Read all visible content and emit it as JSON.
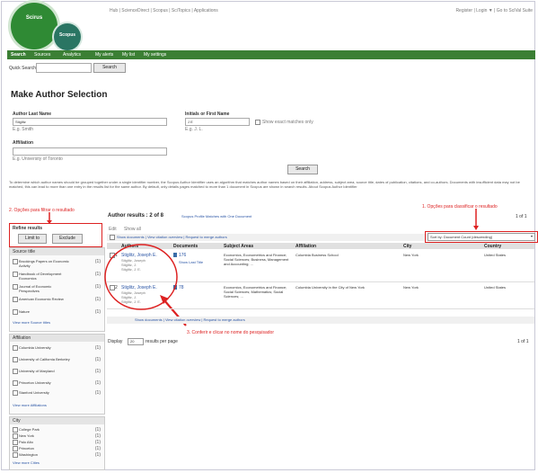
{
  "header": {
    "logo_main": "Scirus",
    "logo_sub": "Scopus",
    "top_links": "Hub | ScienceDirect | Scopus | SciTopics | Applications",
    "user_links": "Register | Login ▼ | Go to SciVal Suite"
  },
  "nav": {
    "items": [
      "Search",
      "Sources",
      "Analytics",
      "My alerts",
      "My list",
      "My settings"
    ]
  },
  "quick_search": {
    "label": "Quick Search",
    "button": "Search"
  },
  "page_title": "Make Author Selection",
  "form": {
    "last_name_label": "Author Last Name",
    "last_name_value": "Stiglitz",
    "last_name_hint": "E.g. Smith",
    "first_name_label": "Initials or First Name",
    "first_name_value": "J E",
    "first_name_hint": "E.g. J. L.",
    "exact_label": "Show exact matches only",
    "affiliation_label": "Affiliation",
    "affiliation_hint": "E.g. University of Toronto",
    "search_button": "Search"
  },
  "info_text": "To determine which author names should be grouped together under a single identifier number, the Scopus Author Identifier uses an algorithm that matches author names based on their affiliation, address, subject area, source title, dates of publication, citations, and co-authors. Documents with insufficient data may not be matched, this can lead to more than one entry in the results list for the same author. By default, only details pages matched to more than 1 document in Scopus are shown in search results. About Scopus Author Identifier",
  "annotations": {
    "refine": "2. Opções para filtrar o resultado",
    "sort": "1. Opções para classificar o resultado",
    "click_name": "3. Conferir e clicar no nome do pesquisador"
  },
  "refine": {
    "title": "Refine results",
    "limit_button": "Limit to",
    "exclude_button": "Exclude"
  },
  "facets": [
    {
      "title": "Source title",
      "items": [
        {
          "label": "Brookings Papers on Economic Activity",
          "count": "(1)"
        },
        {
          "label": "Handbook of Development Economics",
          "count": "(1)"
        },
        {
          "label": "Journal of Economic Perspectives",
          "count": "(1)"
        },
        {
          "label": "American Economic Review",
          "count": "(1)"
        },
        {
          "label": "Nature",
          "count": "(1)"
        }
      ],
      "more": "View more Source titles"
    },
    {
      "title": "Affiliation",
      "items": [
        {
          "label": "Columbia University",
          "count": "(1)"
        },
        {
          "label": "University of California Berkeley",
          "count": "(1)"
        },
        {
          "label": "University of Maryland",
          "count": "(1)"
        },
        {
          "label": "Princeton University",
          "count": "(1)"
        },
        {
          "label": "Stanford University",
          "count": "(1)"
        }
      ],
      "more": "View more Affiliations"
    },
    {
      "title": "City",
      "items": [
        {
          "label": "College Park",
          "count": "(1)"
        },
        {
          "label": "New York",
          "count": "(1)"
        },
        {
          "label": "Palo Alto",
          "count": "(1)"
        },
        {
          "label": "Princeton",
          "count": "(1)"
        },
        {
          "label": "Washington",
          "count": "(1)"
        }
      ],
      "more": "View more Cities"
    }
  ],
  "results": {
    "title": "Author results : 2 of 8",
    "feedback_link": "Scopus Profile Matches with One Document",
    "pager": "1 of 1",
    "edit_label": "Edit",
    "show_all": "Show all",
    "actions": "Show documents | View citation overview | Request to merge authors",
    "sort_label": "Sort by: Document Count (descending)",
    "columns": [
      "Authors",
      "Documents",
      "Subject Areas",
      "Affiliation",
      "City",
      "Country"
    ],
    "rows": [
      {
        "authors": [
          "Stiglitz, Joseph E.",
          "Stiglitz, Joseph",
          "Stiglitz, J.",
          "Stiglitz, J. E."
        ],
        "documents": "176",
        "show_last": "Show Last Title",
        "subjects": "Economics, Econometrics and Finance; Social Sciences; Business, Management and Accounting; ...",
        "affiliation": "Columbia Business School",
        "city": "New York",
        "country": "United States"
      },
      {
        "authors": [
          "Stiglitz, Joseph E.",
          "Stiglitz, Joseph",
          "Stiglitz, J.",
          "Stiglitz, J. E."
        ],
        "documents": "78",
        "show_last": "",
        "subjects": "Economics, Econometrics and Finance; Social Sciences; Mathematics; Social Sciences; ...",
        "affiliation": "Columbia University in the City of New York",
        "city": "New York",
        "country": "United States"
      }
    ],
    "bottom_actions": "Show documents | View citation overview | Request to merge authors",
    "display_label": "Display",
    "display_value": "20",
    "display_suffix": "results per page",
    "page_bottom": "1 of 1"
  }
}
